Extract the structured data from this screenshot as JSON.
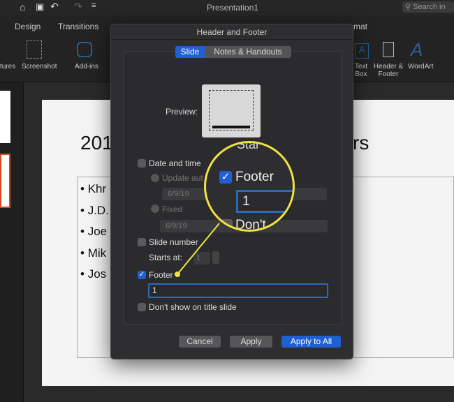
{
  "app": {
    "title": "Presentation1",
    "search_placeholder": "Search in"
  },
  "ribbon": {
    "tabs": [
      "Design",
      "Transitions",
      "mat"
    ],
    "buttons": [
      "tures",
      "Screenshot",
      "Add-ins",
      "Text Box",
      "Header & Footer",
      "WordArt"
    ]
  },
  "slide": {
    "title_left": "201",
    "title_right": "rs",
    "bullets": [
      "Khr",
      "J.D.",
      "Joe",
      "Mik",
      "Jos"
    ]
  },
  "dialog": {
    "title": "Header and Footer",
    "tabs": [
      {
        "label": "Slide",
        "selected": true
      },
      {
        "label": "Notes & Handouts",
        "selected": false
      }
    ],
    "preview_label": "Preview:",
    "date_time": {
      "label": "Date and time",
      "checked": false,
      "update_auto": "Update aut",
      "update_value": "6/9/19",
      "fixed": "Fixed",
      "fixed_value": "6/9/19"
    },
    "slide_number": {
      "label": "Slide number",
      "checked": false,
      "starts_at_label": "Starts at:",
      "starts_at": "1"
    },
    "footer": {
      "label": "Footer",
      "checked": true,
      "value": "1"
    },
    "dont_show": {
      "label": "Don't show on title slide",
      "checked": false
    },
    "buttons": {
      "cancel": "Cancel",
      "apply": "Apply",
      "apply_all": "Apply to All"
    }
  },
  "magnifier": {
    "top_text": "Star",
    "footer_label": "Footer",
    "footer_value": "1",
    "bottom_text": "Don't",
    "color": "#eee443"
  },
  "colors": {
    "accent": "#1f5fd1",
    "highlight": "#eee443"
  }
}
